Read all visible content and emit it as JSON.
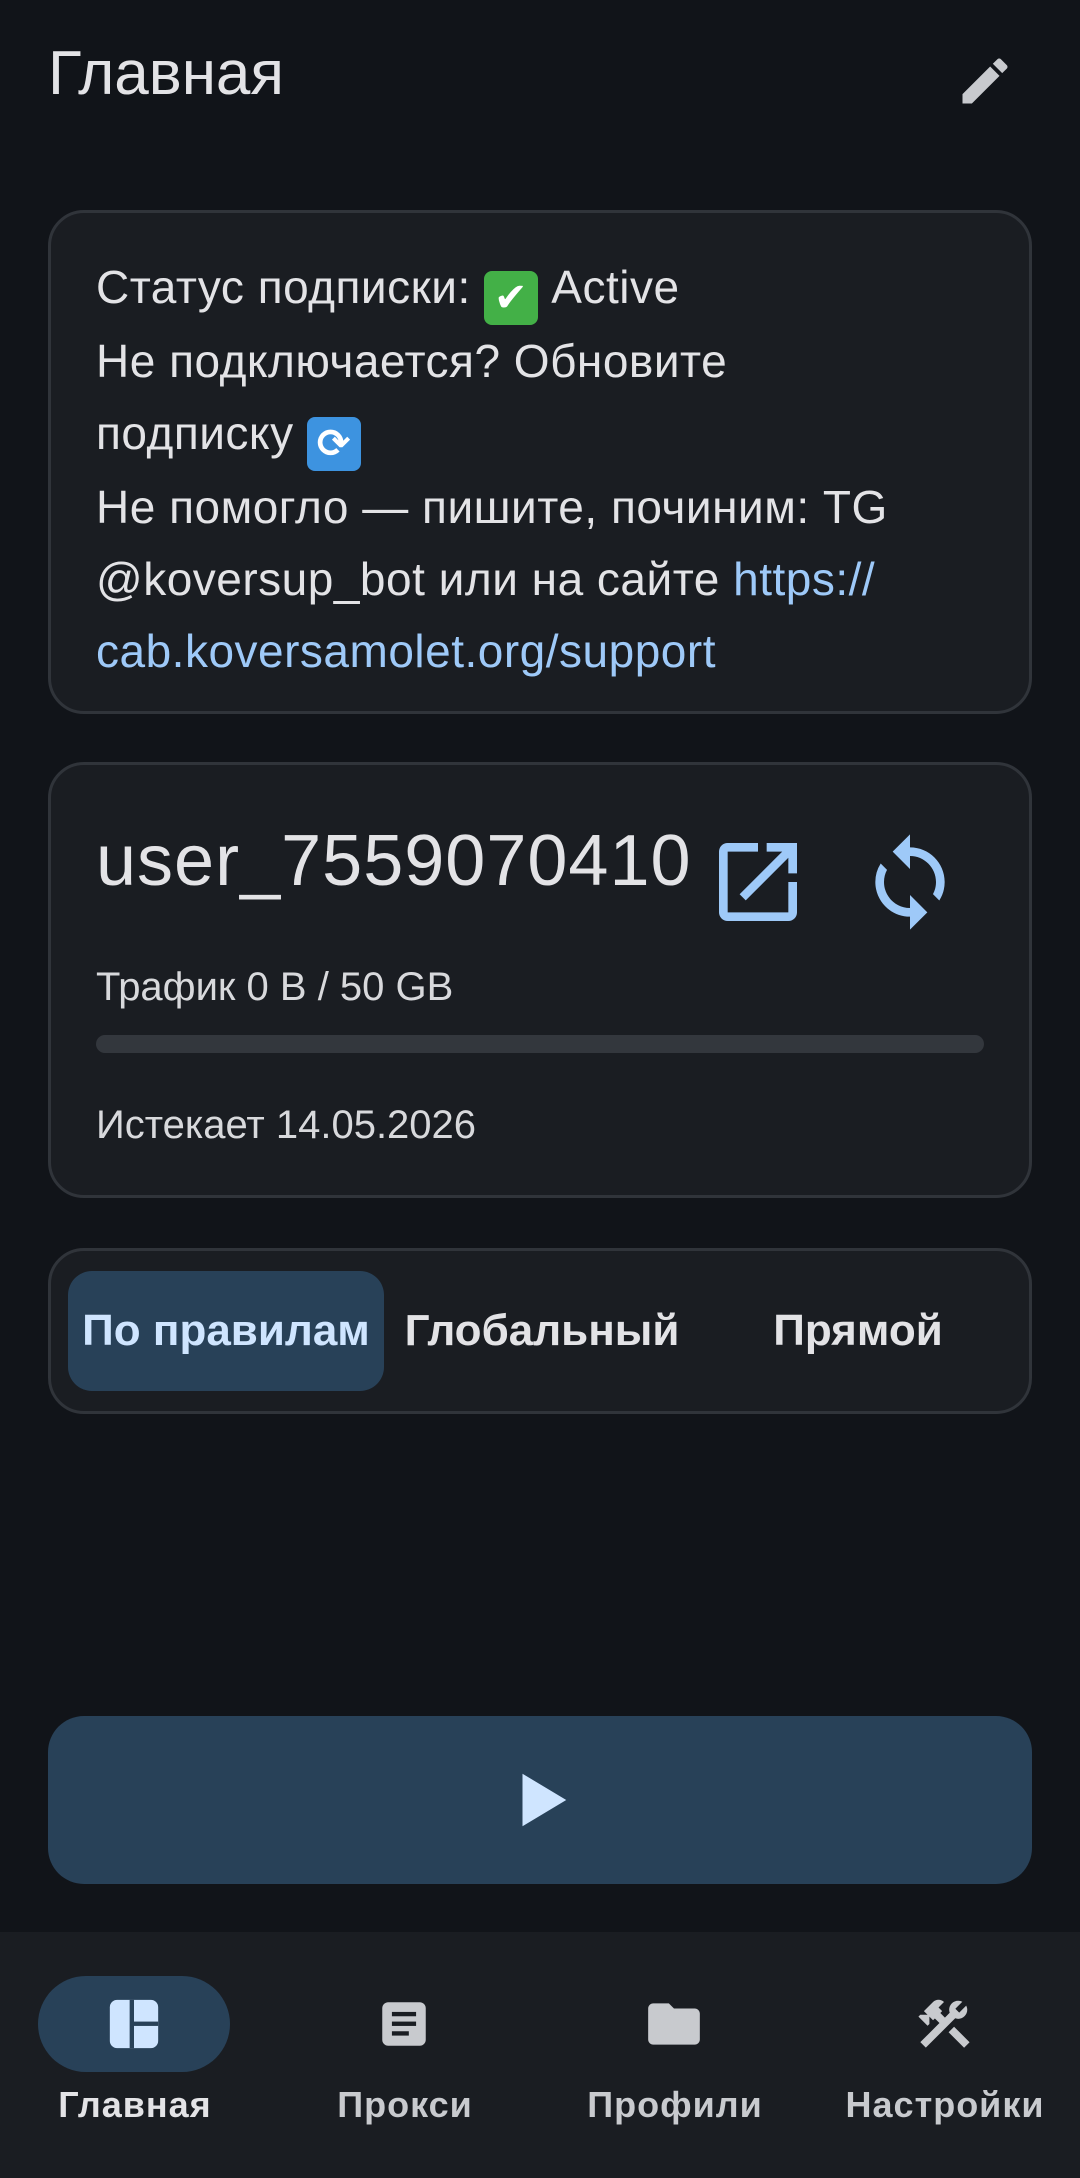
{
  "header": {
    "title": "Главная",
    "edit_icon": "pencil-icon"
  },
  "status": {
    "label": "Статус подписки:",
    "value": "Active",
    "line2": "Не подключается? Обновите",
    "line3": "подписку",
    "line4": "Не помогло — пишите, починим: TG",
    "line5_text": "@koversup_bot или на сайте",
    "line5_link": "https://",
    "line6_link": "cab.koversamolet.org/support",
    "emoji_check": "✔",
    "emoji_refresh": "⟳"
  },
  "profile": {
    "username": "user_7559070410",
    "traffic": "Трафик 0 B / 50 GB",
    "traffic_fraction": 0,
    "expires": "Истекает 14.05.2026",
    "open_icon": "open-in-new-icon",
    "sync_icon": "sync-icon"
  },
  "modes": {
    "items": [
      "По правилам",
      "Глобальный",
      "Прямой"
    ],
    "selected": "По правилам"
  },
  "play": {
    "icon": "play-icon"
  },
  "nav": {
    "items": [
      {
        "label": "Главная",
        "icon": "dashboard-icon"
      },
      {
        "label": "Прокси",
        "icon": "article-icon"
      },
      {
        "label": "Профили",
        "icon": "folder-icon"
      },
      {
        "label": "Настройки",
        "icon": "tools-icon"
      }
    ],
    "active": "Главная"
  },
  "colors": {
    "background": "#111419",
    "card": "#1a1d22",
    "accent": "#9ec9f8",
    "selected": "#284158"
  }
}
